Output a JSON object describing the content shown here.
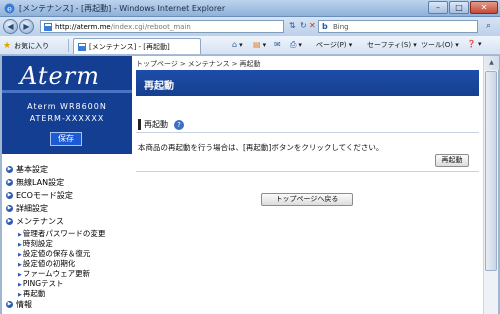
{
  "window": {
    "title": "[メンテナンス] - [再起動] - Windows Internet Explorer",
    "controls": {
      "minimize": "–",
      "maximize": "□",
      "close": "✕"
    }
  },
  "address": {
    "url_host": "http://aterm.me",
    "url_path": "/index.cgi/reboot_main"
  },
  "search": {
    "placeholder": "Bing",
    "brand": "b"
  },
  "favbar": {
    "favorites_label": "お気に入り",
    "tab_label": "[メンテナンス] - [再起動]",
    "commands": {
      "page": "ページ(P) ▾",
      "safety": "セーフティ(S) ▾",
      "tools": "ツール(O) ▾",
      "help": "❓ ▾"
    }
  },
  "sidebar": {
    "logo": "Aterm",
    "model": "Aterm WR8600N",
    "serial": "ATERM-XXXXXX",
    "save_label": "保存",
    "menu": [
      {
        "label": "基本設定"
      },
      {
        "label": "無線LAN設定"
      },
      {
        "label": "ECOモード設定"
      },
      {
        "label": "詳細設定"
      },
      {
        "label": "メンテナンス"
      }
    ],
    "submenu": [
      {
        "label": "管理者パスワードの変更"
      },
      {
        "label": "時刻設定"
      },
      {
        "label": "設定値の保存＆復元"
      },
      {
        "label": "設定値の初期化"
      },
      {
        "label": "ファームウェア更新"
      },
      {
        "label": "PINGテスト"
      },
      {
        "label": "再起動"
      }
    ],
    "menu_after": "情報"
  },
  "main": {
    "breadcrumb": [
      "トップページ",
      "メンテナンス",
      "再起動"
    ],
    "breadcrumb_sep": ">",
    "header_title": "再起動",
    "section_title": "再起動",
    "help_glyph": "?",
    "description": "本商品の再起動を行う場合は、[再起動]ボタンをクリックしてください。",
    "restart_button": "再起動",
    "top_button": "トップページへ戻る"
  },
  "colors": {
    "brand_blue": "#143e92",
    "header_blue": "#1e4eaa",
    "save_button": "#1d5ad4"
  }
}
